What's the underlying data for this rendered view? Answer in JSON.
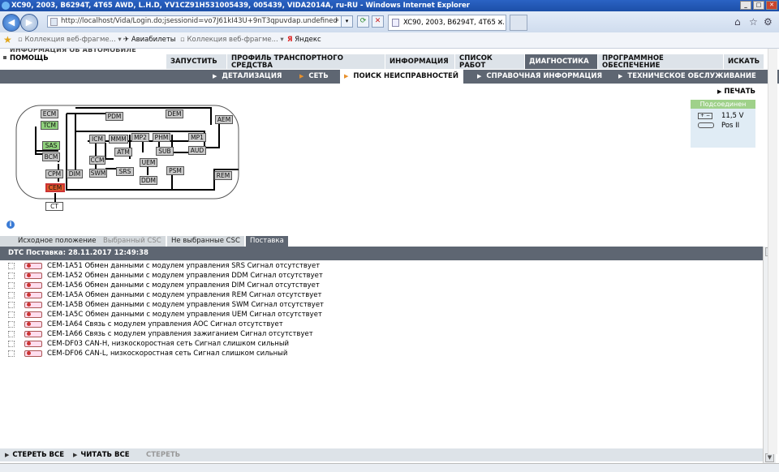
{
  "window": {
    "title": "XC90, 2003, B6294T, 4T65 AWD, L.H.D, YV1CZ91H531005439, 005439, VIDA2014A, ru-RU - Windows Internet Explorer"
  },
  "browser": {
    "address": "http://localhost/Vida/Login.do;jsessionid=vo7J61kI43U+9nT3qpuvdap.undefined",
    "tab_title": "XC90, 2003, B6294T, 4T65 ...",
    "favorites": [
      {
        "label": "Коллекция веб-фрагме...",
        "icon": "web-slice-icon"
      },
      {
        "label": "Авиабилеты",
        "icon": "plane-icon"
      },
      {
        "label": "Коллекция веб-фрагме...",
        "icon": "web-slice-icon"
      },
      {
        "label": "Яндекс",
        "icon": "yandex-icon"
      }
    ]
  },
  "app": {
    "brand": "ИНФОРМАЦИЯ ОБ АВТОМОБИЛЕ",
    "help": "ПОМОЩЬ",
    "main_tabs": [
      {
        "label": "ЗАПУСТИТЬ"
      },
      {
        "label": "ПРОФИЛЬ ТРАНСПОРТНОГО СРЕДСТВА"
      },
      {
        "label": "ИНФОРМАЦИЯ"
      },
      {
        "label": "СПИСОК РАБОТ"
      },
      {
        "label": "ДИАГНОСТИКА"
      },
      {
        "label": "ПРОГРАММНОЕ ОБЕСПЕЧЕНИЕ"
      },
      {
        "label": "ИСКАТЬ"
      }
    ],
    "sub_tabs": [
      {
        "label": "ДЕТАЛИЗАЦИЯ"
      },
      {
        "label": "СЕТЬ"
      },
      {
        "label": "ПОИСК НЕИСПРАВНОСТЕЙ"
      },
      {
        "label": "СПРАВОЧНАЯ ИНФОРМАЦИЯ"
      },
      {
        "label": "ТЕХНИЧЕСКОЕ ОБСЛУЖИВАНИЕ"
      }
    ],
    "print": "ПЕЧАТЬ",
    "status": {
      "connected": "Подсоединен",
      "voltage": "11,5 V",
      "ignition": "Pos II"
    },
    "modules": [
      "ECM",
      "TCM",
      "SAS",
      "BCM",
      "CPM",
      "CEM",
      "CT",
      "DIM",
      "PDM",
      "DEM",
      "ICM",
      "MMM",
      "MP2",
      "PHM",
      "MP1",
      "AEM",
      "ATM",
      "SUB",
      "AUD",
      "CCM",
      "SWM",
      "SRS",
      "UEM",
      "DDM",
      "PSM",
      "REM"
    ],
    "colors": {
      "ok_module": "#8fd07c",
      "fault_module": "#e05a2a",
      "default_module": "#c8c8c8",
      "header": "#5e6672"
    },
    "result_tabs": [
      {
        "label": "Исходное положение"
      },
      {
        "label": "Выбранный CSC"
      },
      {
        "label": "Не выбранные CSC"
      },
      {
        "label": "Поставка"
      }
    ],
    "dtc_header": "DTC Поставка: 28.11.2017 12:49:38",
    "dtc_list": [
      "CEM-1A51 Обмен данными с модулем управления SRS Сигнал отсутствует",
      "CEM-1A52 Обмен данными с модулем управления DDM Сигнал отсутствует",
      "CEM-1A56 Обмен данными с модулем управления DIM Сигнал отсутствует",
      "CEM-1A5A Обмен данными с модулем управления REM Сигнал отсутствует",
      "CEM-1A5B Обмен данными с модулем управления SWM Сигнал отсутствует",
      "CEM-1A5C Обмен данными с модулем управления UEM Сигнал отсутствует",
      "CEM-1A64 Связь с модулем управления AOC Сигнал отсутствует",
      "CEM-1A66 Связь с модулем управления зажиганием Сигнал отсутствует",
      "CEM-DF03 CAN-H, низкоскоростная сеть Сигнал слишком сильный",
      "CEM-DF06 CAN-L, низкоскоростная сеть Сигнал слишком сильный"
    ],
    "footer": {
      "clear_all": "СТЕРЕТЬ ВСЕ",
      "read_all": "ЧИТАТЬ ВСЕ",
      "clear": "СТЕРЕТЬ"
    }
  }
}
